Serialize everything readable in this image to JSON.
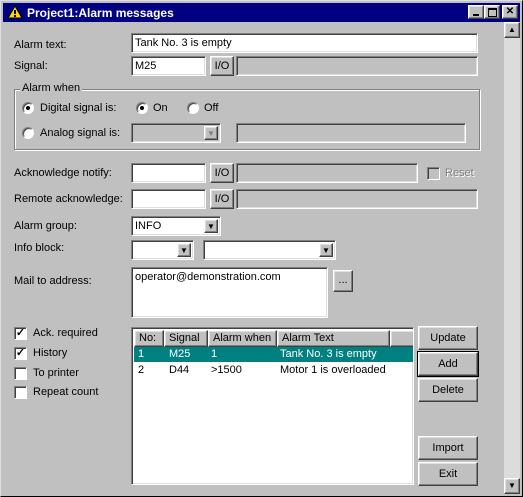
{
  "window": {
    "title": "Project1:Alarm messages"
  },
  "labels": {
    "alarm_text": "Alarm text:",
    "signal": "Signal:",
    "alarm_when": "Alarm when",
    "digital_signal": "Digital signal is:",
    "on": "On",
    "off": "Off",
    "analog_signal": "Analog signal is:",
    "ack_notify": "Acknowledge notify:",
    "reset": "Reset",
    "remote_ack": "Remote acknowledge:",
    "alarm_group": "Alarm group:",
    "info_block": "Info block:",
    "mail_to": "Mail to address:",
    "io": "I/O",
    "ellipsis": "..."
  },
  "values": {
    "alarm_text": "Tank No. 3 is empty",
    "signal": "M25",
    "alarm_group": "INFO",
    "mail_to": "operator@demonstration.com"
  },
  "checkboxes": [
    {
      "label": "Ack. required",
      "checked": true
    },
    {
      "label": "History",
      "checked": true
    },
    {
      "label": "To printer",
      "checked": false
    },
    {
      "label": "Repeat count",
      "checked": false
    }
  ],
  "list": {
    "columns": [
      "No:",
      "Signal",
      "Alarm when",
      "Alarm Text"
    ],
    "rows": [
      {
        "no": "1",
        "signal": "M25",
        "when": "1",
        "text": "Tank No. 3 is empty",
        "selected": true
      },
      {
        "no": "2",
        "signal": "D44",
        "when": ">1500",
        "text": "Motor 1 is overloaded",
        "selected": false
      }
    ]
  },
  "buttons": {
    "update": "Update",
    "add": "Add",
    "delete": "Delete",
    "import": "Import",
    "exit": "Exit"
  },
  "colors": {
    "titlebar": "#000080",
    "selection": "#008080"
  }
}
